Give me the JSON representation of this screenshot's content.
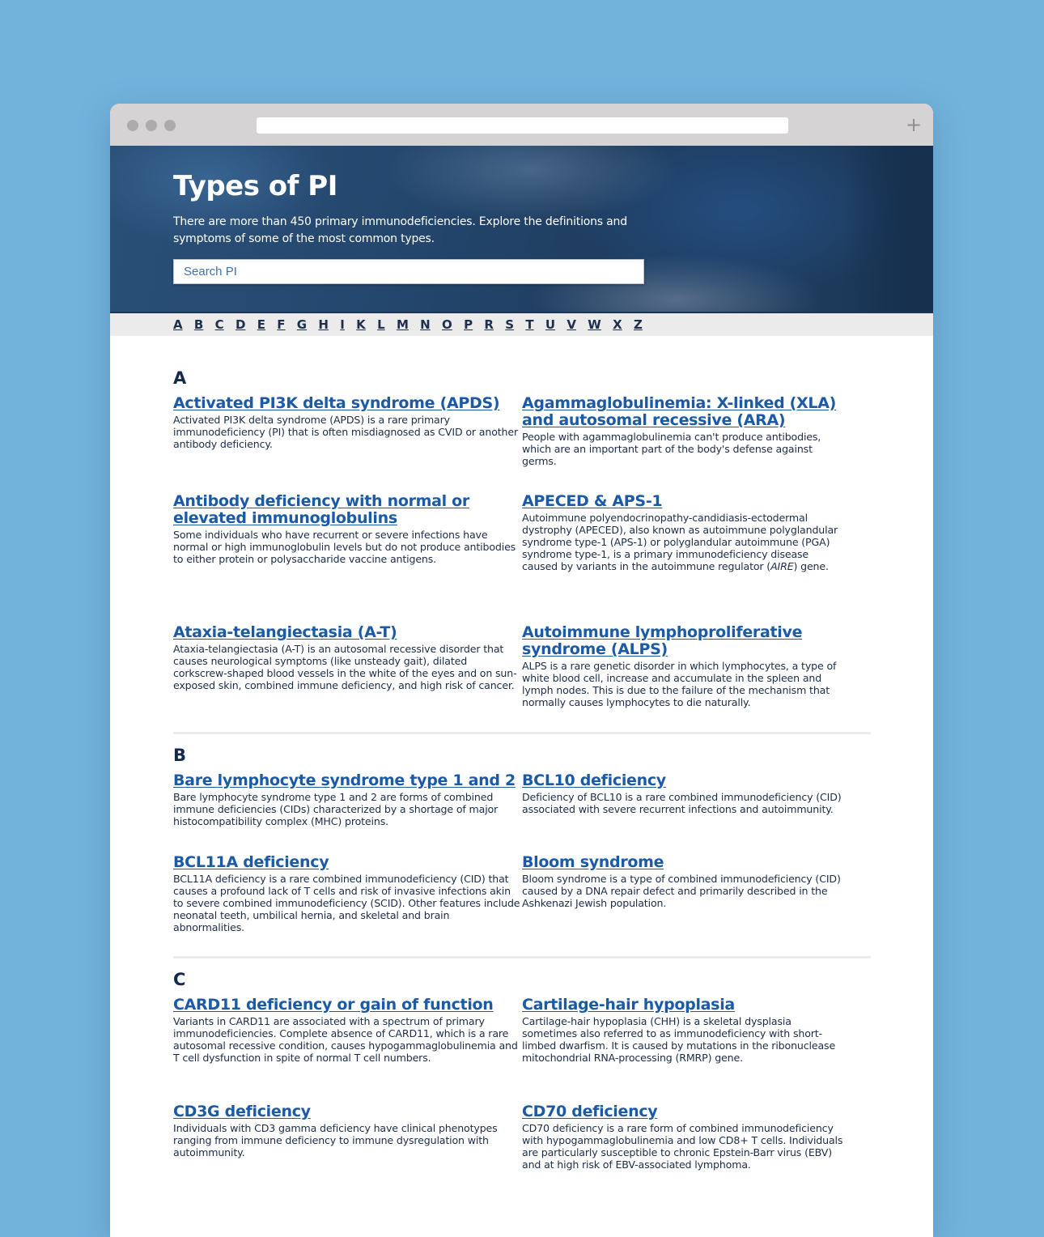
{
  "browser": {
    "new_tab_icon": "plus-icon",
    "url": ""
  },
  "hero": {
    "title": "Types of PI",
    "description": "There are more than 450 primary immunodeficiencies. Explore the definitions and symptoms of some of the most common types.",
    "search_placeholder": "Search PI",
    "search_value": ""
  },
  "alphabet": [
    "A",
    "B",
    "C",
    "D",
    "E",
    "F",
    "G",
    "H",
    "I",
    "K",
    "L",
    "M",
    "N",
    "O",
    "P",
    "R",
    "S",
    "T",
    "U",
    "V",
    "W",
    "X",
    "Z"
  ],
  "sections": [
    {
      "letter": "A",
      "entries": [
        {
          "title": "Activated PI3K delta syndrome (APDS)",
          "description": "Activated PI3K delta syndrome (APDS) is a rare primary immunodeficiency (PI) that is often misdiagnosed as CVID or another antibody deficiency."
        },
        {
          "title": "Agammaglobulinemia: X-linked (XLA) and autosomal recessive (ARA)",
          "description": "People with agammaglobulinemia can't produce antibodies, which are an important part of the body's defense against germs."
        },
        {
          "title": "Antibody deficiency with normal or elevated immunoglobulins",
          "description": "Some individuals who have recurrent or severe infections have normal or high immunoglobulin levels but do not produce antibodies to either protein or polysaccharide vaccine antigens."
        },
        {
          "title": "APECED & APS-1",
          "description_pre": "Autoimmune polyendocrinopathy-candidiasis-ectodermal dystrophy (APECED), also known as autoimmune polyglandular syndrome type-1 (APS-1) or polyglandular autoimmune (PGA) syndrome type-1, is a primary immunodeficiency disease caused by variants in the autoimmune regulator (",
          "description_italic": "AIRE",
          "description_post": ") gene."
        },
        {
          "title": "Ataxia-telangiectasia (A-T)",
          "description": "Ataxia-telangiectasia (A-T) is an autosomal recessive disorder that causes neurological symptoms (like unsteady gait), dilated corkscrew-shaped blood vessels in the white of the eyes and on sun-exposed skin, combined immune deficiency, and high risk of cancer."
        },
        {
          "title": "Autoimmune lymphoproliferative syndrome (ALPS)",
          "description": "ALPS is a rare genetic disorder in which lymphocytes, a type of white blood cell, increase and accumulate in the spleen and lymph nodes. This is due to the failure of the mechanism that normally causes lymphocytes to die naturally."
        }
      ]
    },
    {
      "letter": "B",
      "entries": [
        {
          "title": "Bare lymphocyte syndrome type 1 and 2",
          "description": "Bare lymphocyte syndrome type 1 and 2 are forms of combined immune deficiencies (CIDs) characterized by a shortage of major histocompatibility complex (MHC) proteins."
        },
        {
          "title": "BCL10 deficiency",
          "description": "Deficiency of BCL10 is a rare combined immunodeficiency (CID) associated with severe recurrent infections and autoimmunity."
        },
        {
          "title": "BCL11A deficiency",
          "description": "BCL11A deficiency is a rare combined immunodeficiency (CID) that causes a profound lack of T cells and risk of invasive infections akin to severe combined immunodeficiency (SCID). Other features include neonatal teeth, umbilical hernia, and skeletal and brain abnormalities."
        },
        {
          "title": "Bloom syndrome",
          "description": "Bloom syndrome is a type of combined immunodeficiency (CID) caused by a DNA repair defect and primarily described in the Ashkenazi Jewish population."
        }
      ]
    },
    {
      "letter": "C",
      "entries": [
        {
          "title": "CARD11 deficiency or gain of function",
          "description": "Variants in CARD11 are associated with a spectrum of primary immunodeficiencies. Complete absence of CARD11, which is a rare autosomal recessive condition, causes hypogammaglobulinemia and T cell dysfunction in spite of normal T cell numbers."
        },
        {
          "title": "Cartilage-hair hypoplasia",
          "description": "Cartilage-hair hypoplasia (CHH) is a skeletal dysplasia sometimes also referred to as immunodeficiency with short-limbed dwarfism. It is caused by mutations in the ribonuclease mitochondrial RNA-processing (RMRP) gene."
        },
        {
          "title": "CD3G deficiency",
          "description": "Individuals with CD3 gamma deficiency have clinical phenotypes ranging from immune deficiency to immune dysregulation with autoimmunity."
        },
        {
          "title": "CD70 deficiency",
          "description": "CD70 deficiency is a rare form of combined immunodeficiency with hypogammaglobulinemia and low CD8+ T cells. Individuals are particularly susceptible to chronic Epstein-Barr virus (EBV) and at high risk of EBV-associated lymphoma."
        }
      ]
    }
  ]
}
